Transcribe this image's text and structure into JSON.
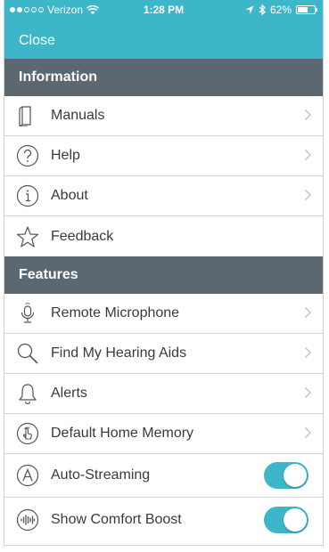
{
  "status_bar": {
    "carrier": "Verizon",
    "time": "1:28 PM",
    "battery": "62%",
    "battery_level": 0.62
  },
  "header": {
    "close_label": "Close"
  },
  "colors": {
    "accent": "#3db6c9",
    "section_header": "#5b6771"
  },
  "sections": [
    {
      "title": "Information",
      "items": [
        {
          "label": "Manuals",
          "icon": "book-icon"
        },
        {
          "label": "Help",
          "icon": "question-circle-icon"
        },
        {
          "label": "About",
          "icon": "info-circle-icon"
        },
        {
          "label": "Feedback",
          "icon": "star-icon"
        }
      ]
    },
    {
      "title": "Features",
      "items": [
        {
          "label": "Remote Microphone",
          "icon": "microphone-icon"
        },
        {
          "label": "Find My Hearing Aids",
          "icon": "search-icon"
        },
        {
          "label": "Alerts",
          "icon": "bell-icon"
        },
        {
          "label": "Default Home Memory",
          "icon": "hand-touch-icon"
        },
        {
          "label": "Auto-Streaming",
          "icon": "letter-a-circle-icon",
          "toggle": true
        },
        {
          "label": "Show Comfort Boost",
          "icon": "sound-wave-icon",
          "toggle": true
        }
      ]
    }
  ]
}
